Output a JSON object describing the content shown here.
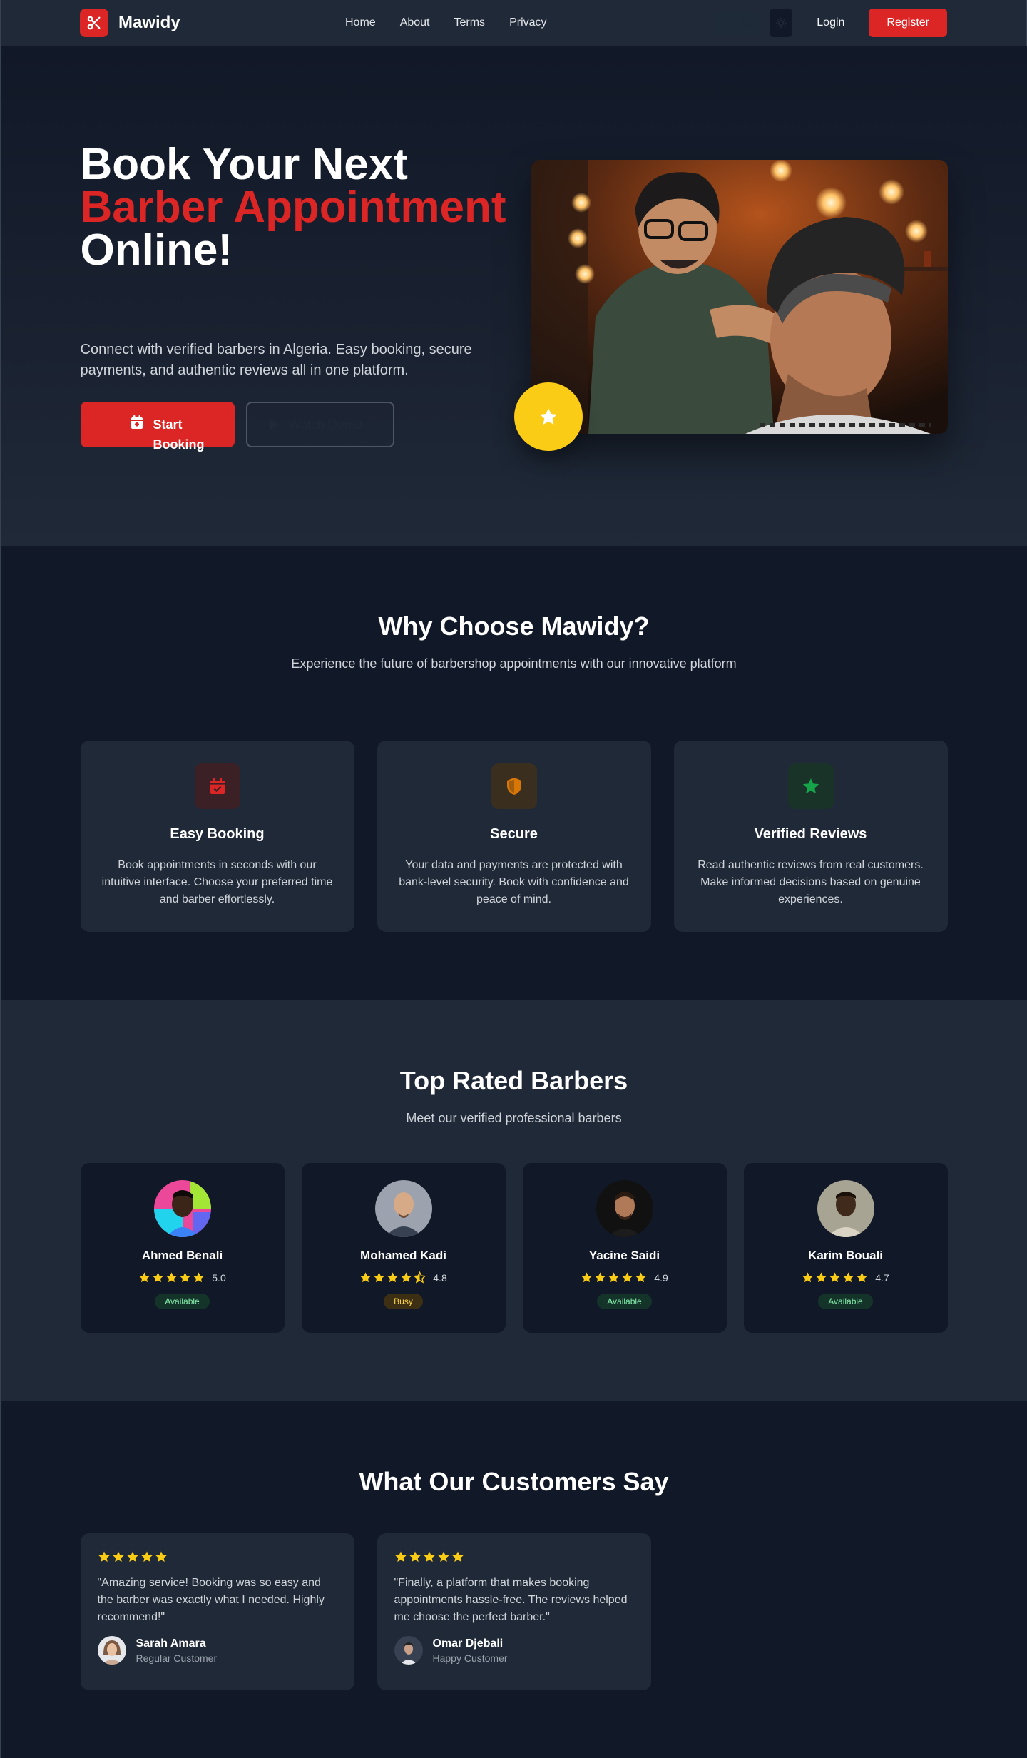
{
  "nav": {
    "brand": "Mawidy",
    "links": [
      "Home",
      "About",
      "Terms",
      "Privacy"
    ],
    "lang": "EN",
    "login": "Login",
    "register": "Register"
  },
  "hero": {
    "title_line1": "Book Your Next",
    "title_line2": "Barber Appointment",
    "title_line3": "Online!",
    "description": "Connect with verified barbers in Algeria. Easy booking, secure payments, and authentic reviews all in one platform.",
    "start_booking": "Start Booking",
    "watch_demo": "Watch Demo"
  },
  "why": {
    "title": "Why Choose Mawidy?",
    "subtitle": "Experience the future of barbershop appointments with our innovative platform",
    "features": [
      {
        "title": "Easy Booking",
        "text": "Book appointments in seconds with our intuitive interface. Choose your preferred time and barber effortlessly.",
        "icon": "calendar-check-icon",
        "color": "#dc2626"
      },
      {
        "title": "Secure",
        "text": "Your data and payments are protected with bank-level security. Book with confidence and peace of mind.",
        "icon": "shield-icon",
        "color": "#d97706"
      },
      {
        "title": "Verified Reviews",
        "text": "Read authentic reviews from real customers. Make informed decisions based on genuine experiences.",
        "icon": "star-icon",
        "color": "#16a34a"
      }
    ]
  },
  "barbers": {
    "title": "Top Rated Barbers",
    "subtitle": "Meet our verified professional barbers",
    "items": [
      {
        "name": "Ahmed Benali",
        "rating": "5.0",
        "stars": 5,
        "status": "Available"
      },
      {
        "name": "Mohamed Kadi",
        "rating": "4.8",
        "stars": 4.5,
        "status": "Busy"
      },
      {
        "name": "Yacine Saidi",
        "rating": "4.9",
        "stars": 5,
        "status": "Available"
      },
      {
        "name": "Karim Bouali",
        "rating": "4.7",
        "stars": 5,
        "status": "Available"
      }
    ]
  },
  "testimonials": {
    "title": "What Our Customers Say",
    "items": [
      {
        "quote": "\"Amazing service! Booking was so easy and the barber was exactly what I needed. Highly recommend!\"",
        "name": "Sarah Amara",
        "role": "Regular Customer",
        "stars": 5
      },
      {
        "quote": "\"Finally, a platform that makes booking appointments hassle-free. The reviews helped me choose the perfect barber.\"",
        "name": "Omar Djebali",
        "role": "Happy Customer",
        "stars": 5
      }
    ]
  },
  "colors": {
    "accent": "#dc2626",
    "star": "#facc15",
    "bg_dark": "#111827",
    "bg_card": "#1f2937"
  }
}
